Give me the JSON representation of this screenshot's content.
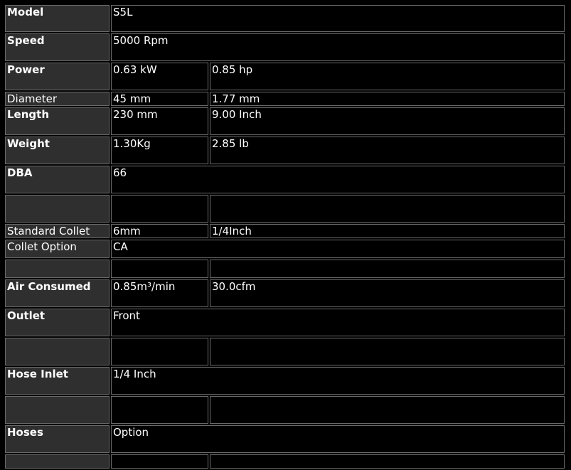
{
  "rows": [
    {
      "label": "Model",
      "bold": true,
      "v1": "S5L",
      "v2": null
    },
    {
      "label": "Speed",
      "bold": true,
      "v1": "5000 Rpm",
      "v2": null
    },
    {
      "label": "Power",
      "bold": true,
      "v1": "0.63 kW",
      "v2": "0.85 hp"
    },
    {
      "label": "Diameter",
      "bold": false,
      "v1": "45 mm",
      "v2": "1.77 mm"
    },
    {
      "label": "Length",
      "bold": true,
      "v1": "230 mm",
      "v2": "9.00 Inch"
    },
    {
      "label": "Weight",
      "bold": true,
      "v1": "1.30Kg",
      "v2": "2.85 lb"
    },
    {
      "label": "DBA",
      "bold": true,
      "v1": "66",
      "v2": null
    },
    {
      "label": "",
      "bold": false,
      "v1": "",
      "v2": ""
    },
    {
      "label": "Standard Collet",
      "bold": false,
      "v1": "6mm",
      "v2": "1/4Inch"
    },
    {
      "label": "Collet Option",
      "bold": false,
      "v1": "CA",
      "v2": null
    },
    {
      "label": "",
      "bold": false,
      "v1": "",
      "v2": ""
    },
    {
      "label": "Air Consumed",
      "bold": true,
      "v1": "0.85m³/min",
      "v2": "30.0cfm"
    },
    {
      "label": "Outlet",
      "bold": true,
      "v1": "Front",
      "v2": null
    },
    {
      "label": "",
      "bold": false,
      "v1": "",
      "v2": ""
    },
    {
      "label": "Hose Inlet",
      "bold": true,
      "v1": "1/4 Inch",
      "v2": null
    },
    {
      "label": "",
      "bold": false,
      "v1": "",
      "v2": ""
    },
    {
      "label": "Hoses",
      "bold": true,
      "v1": "Option",
      "v2": null
    },
    {
      "label": "",
      "bold": false,
      "v1": "",
      "v2": ""
    }
  ]
}
